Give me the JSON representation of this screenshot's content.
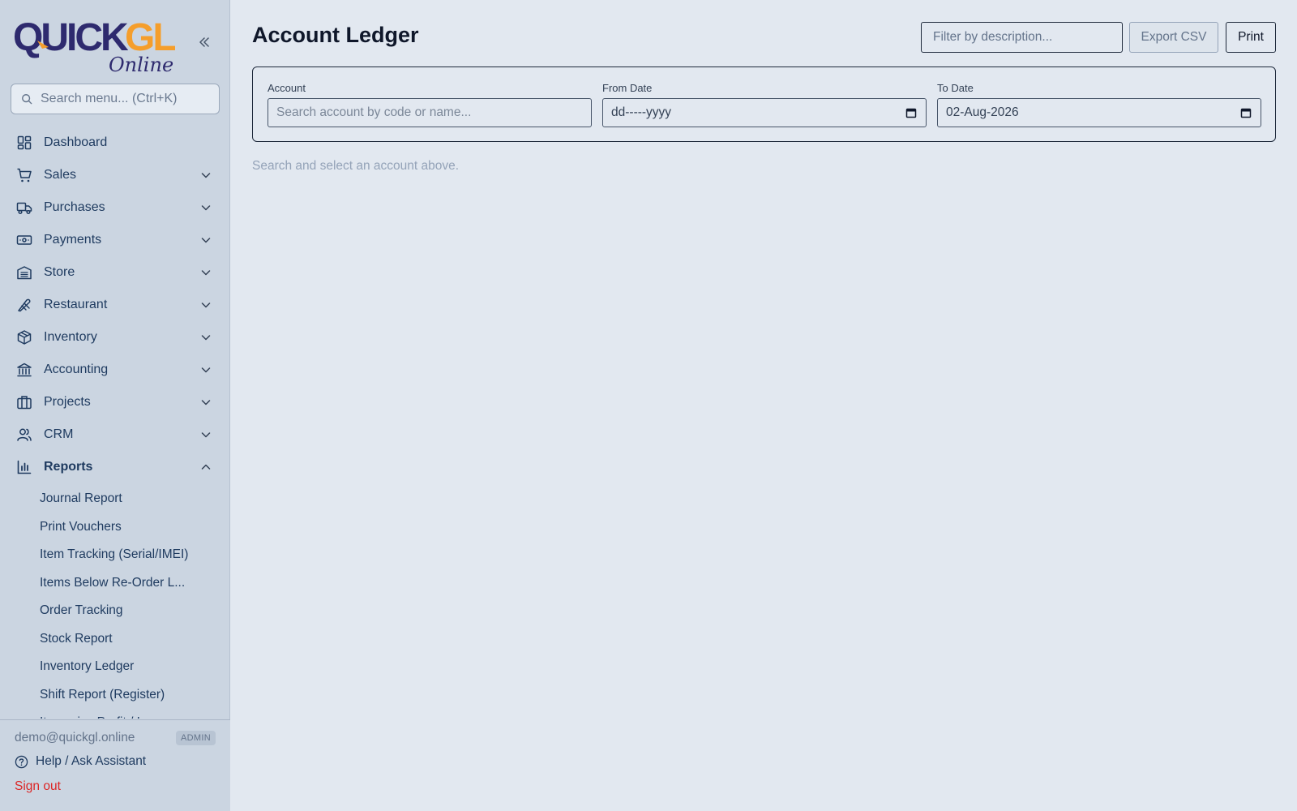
{
  "brand": {
    "logo_text_main": "QuickGL",
    "logo_text_sub": "Online",
    "primary_color": "#2e2a6e",
    "accent_color": "#f59e2b"
  },
  "sidebar": {
    "search_placeholder": "Search menu... (Ctrl+K)",
    "items": [
      {
        "label": "Dashboard",
        "icon": "dashboard-icon",
        "expandable": false
      },
      {
        "label": "Sales",
        "icon": "cart-icon",
        "expandable": true
      },
      {
        "label": "Purchases",
        "icon": "truck-icon",
        "expandable": true
      },
      {
        "label": "Payments",
        "icon": "banknote-icon",
        "expandable": true
      },
      {
        "label": "Store",
        "icon": "warehouse-icon",
        "expandable": true
      },
      {
        "label": "Restaurant",
        "icon": "utensils-icon",
        "expandable": true
      },
      {
        "label": "Inventory",
        "icon": "box-icon",
        "expandable": true
      },
      {
        "label": "Accounting",
        "icon": "bank-icon",
        "expandable": true
      },
      {
        "label": "Projects",
        "icon": "briefcase-icon",
        "expandable": true
      },
      {
        "label": "CRM",
        "icon": "users-icon",
        "expandable": true
      },
      {
        "label": "Reports",
        "icon": "bar-chart-icon",
        "expandable": true,
        "expanded": true
      }
    ],
    "reports_subitems": [
      "Journal Report",
      "Print Vouchers",
      "Item Tracking (Serial/IMEI)",
      "Items Below Re-Order L...",
      "Order Tracking",
      "Stock Report",
      "Inventory Ledger",
      "Shift Report (Register)",
      "Item-wise Profit / Loss"
    ],
    "footer": {
      "email": "demo@quickgl.online",
      "role": "ADMIN",
      "help_label": "Help / Ask Assistant",
      "signout_label": "Sign out"
    }
  },
  "main": {
    "title": "Account Ledger",
    "filter_placeholder": "Filter by description...",
    "export_label": "Export CSV",
    "print_label": "Print",
    "fields": {
      "account_label": "Account",
      "account_placeholder": "Search account by code or name...",
      "from_label": "From Date",
      "from_value": "dd-----yyyy",
      "to_label": "To Date",
      "to_value": "02-Aug-2026"
    },
    "hint": "Search and select an account above."
  }
}
